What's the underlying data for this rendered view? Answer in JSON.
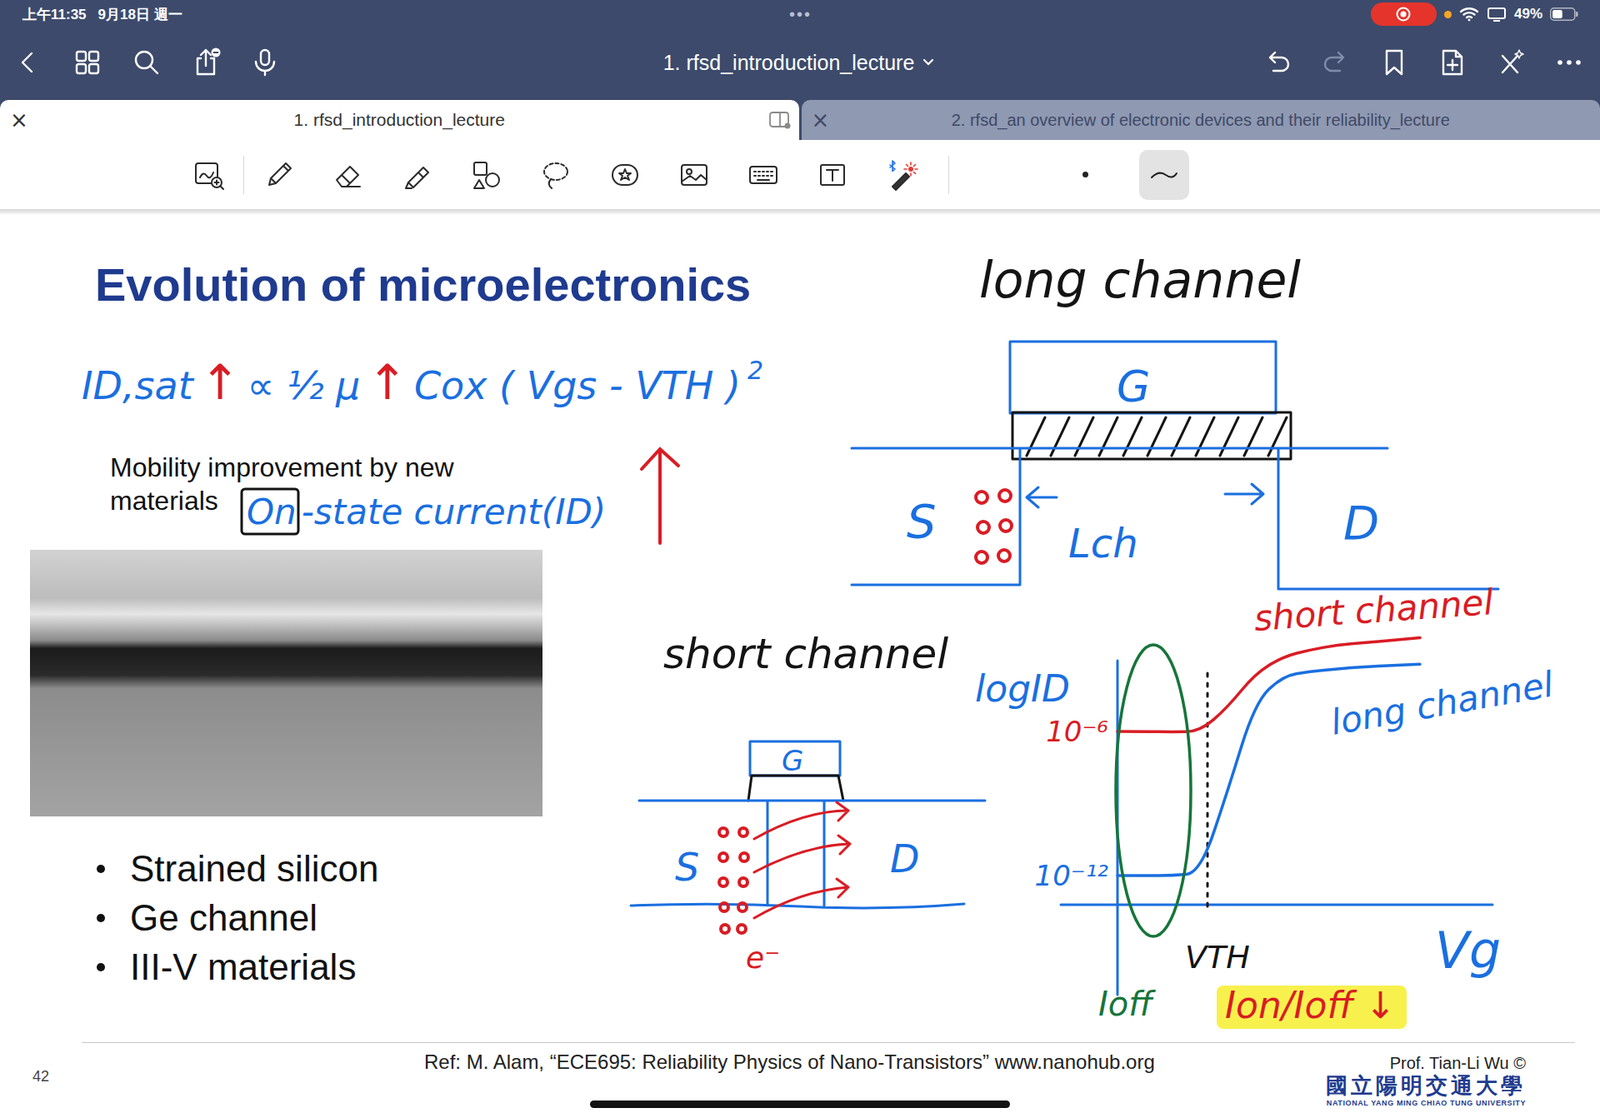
{
  "status_bar": {
    "time": "上午11:35",
    "date": "9月18日 週一",
    "handle": "•••",
    "recording": true,
    "battery": {
      "reading": "49%",
      "level": 0.49
    }
  },
  "nav_bar": {
    "title": "1. rfsd_introduction_lecture",
    "redo_disabled": true
  },
  "tabs": [
    {
      "label": "1. rfsd_introduction_lecture",
      "close": "×",
      "selected": true
    },
    {
      "label": "2. rfsd_an overview of electronic devices and their reliability_lecture",
      "close": "×",
      "selected": false
    }
  ],
  "toolbar": {
    "tools": [
      {
        "kind": "zoom-window",
        "selected": false
      },
      {
        "kind": "pen",
        "selected": false
      },
      {
        "kind": "eraser",
        "selected": false
      },
      {
        "kind": "highlighter",
        "selected": false
      },
      {
        "kind": "shapes",
        "selected": false
      },
      {
        "kind": "lasso",
        "selected": false
      },
      {
        "kind": "elements",
        "selected": false
      },
      {
        "kind": "image",
        "selected": false
      },
      {
        "kind": "keyboard",
        "selected": false
      },
      {
        "kind": "textbox",
        "selected": false
      },
      {
        "kind": "laser",
        "selected": false
      }
    ],
    "stroke_options": [
      {
        "kind": "dot",
        "selected": false
      },
      {
        "kind": "curve",
        "selected": true
      }
    ]
  },
  "slide": {
    "title": "Evolution of microelectronics",
    "text": "Mobility improvement by new materials",
    "bullets": [
      "Strained silicon",
      "Ge channel",
      "III-V materials"
    ],
    "reference": "Ref: M. Alam, “ECE695: Reliability Physics of Nano-Transistors” www.nanohub.org",
    "page_number": "42",
    "author": "Prof. Tian-Li Wu ©",
    "institution": "國立陽明交通大學",
    "institution_en": "NATIONAL YANG MING CHIAO TUNG UNIVERSITY"
  },
  "annotations": {
    "formula": [
      {
        "text": "ID,sat",
        "kind": "text",
        "color": "#1a6fe0"
      },
      {
        "text": "↑",
        "kind": "text",
        "color": "#d91c24"
      },
      {
        "text": "∝ ½ μ",
        "kind": "text",
        "color": "#1a6fe0"
      },
      {
        "text": "↑",
        "kind": "text",
        "color": "#d91c24"
      },
      {
        "text": "Cox ( Vgs - VTH )",
        "kind": "text",
        "color": "#1a6fe0"
      },
      {
        "text": "2",
        "kind": "sup",
        "color": "#1a6fe0"
      }
    ],
    "on_state": {
      "boxed": "On",
      "text": "-state current(ID)"
    },
    "long_channel": {
      "title": "long channel",
      "gate": "G",
      "source": "S",
      "drain": "D",
      "length": "Lch"
    },
    "short_channel": {
      "title": "short channel",
      "gate": "G",
      "source": "S",
      "drain": "D",
      "carrier": "e⁻"
    },
    "plot": {
      "y_label": "logID",
      "x_label": "Vg",
      "threshold": "VTH",
      "off_label": "Ioff",
      "ratio_label": "Ion/Ioff ↓",
      "y_ticks": [
        {
          "label": "10⁻⁶",
          "value": -6,
          "color": "#d91c24"
        },
        {
          "label": "10⁻¹²",
          "value": -12,
          "color": "#1a6fe0"
        }
      ],
      "series": [
        {
          "label": "short channel",
          "color": "#d91c24",
          "values": [
            -6,
            -6,
            -6.02,
            -6,
            -5,
            -3.6,
            -2.9,
            -2.6,
            -2.4,
            -2.3,
            -2.2,
            -2.1
          ]
        },
        {
          "label": "long channel",
          "color": "#1a6fe0",
          "values": [
            -12,
            -12,
            -12,
            -11.9,
            -8.5,
            -4.8,
            -3.7,
            -3.5,
            -3.4,
            -3.3,
            -3.25,
            -3.2
          ]
        }
      ]
    }
  }
}
